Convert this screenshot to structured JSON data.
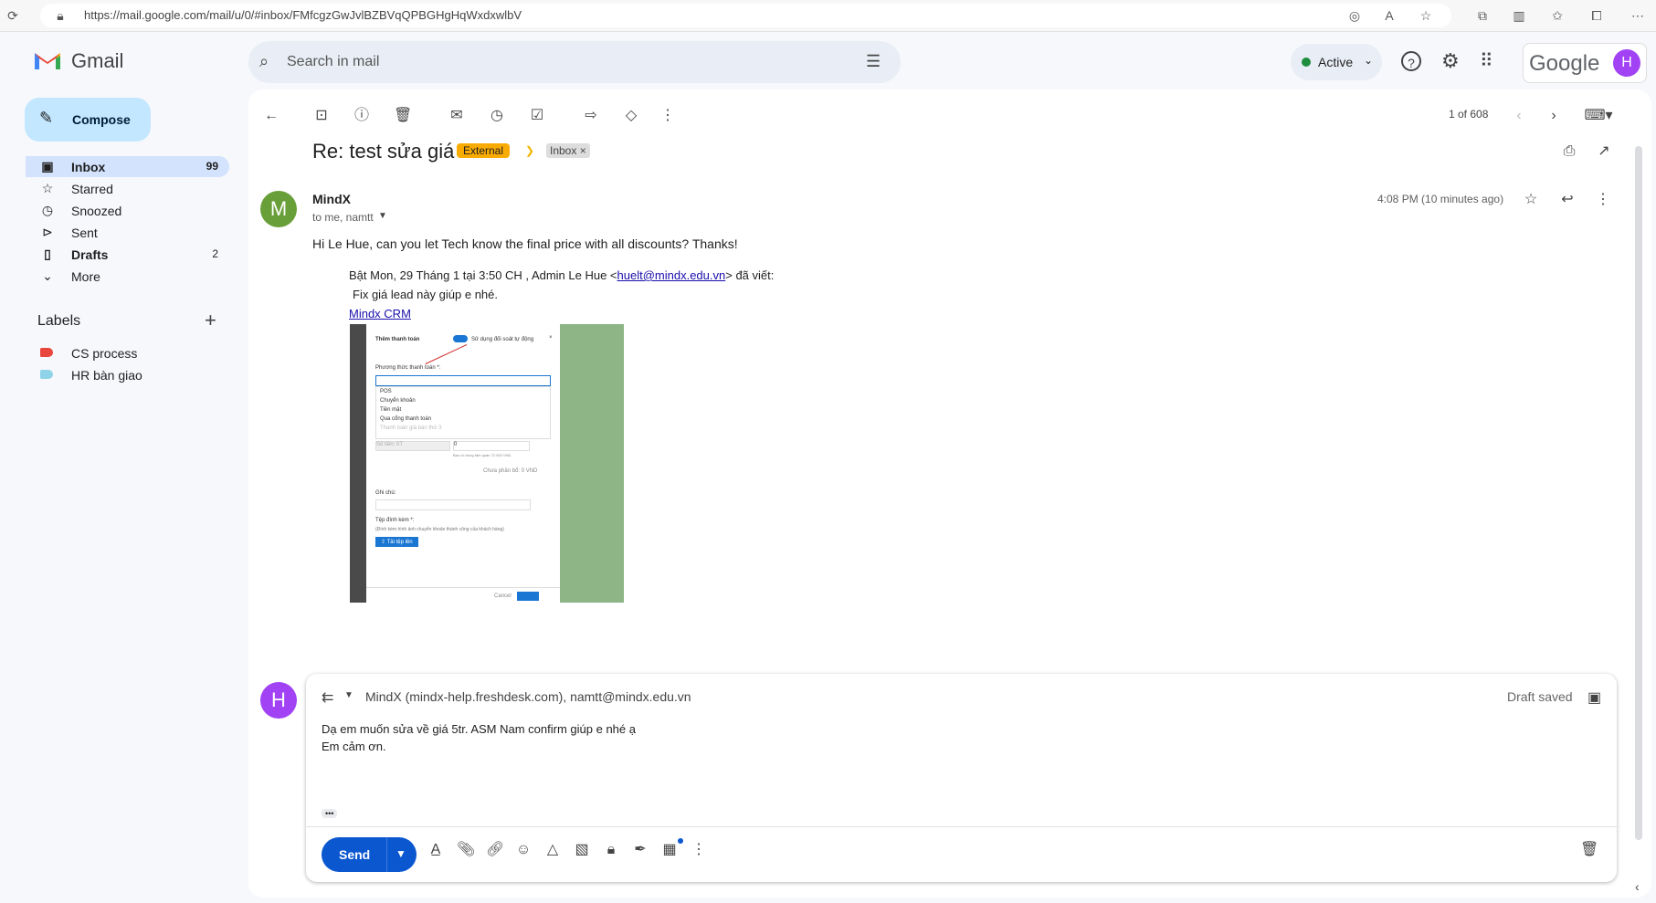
{
  "browser": {
    "url": "https://mail.google.com/mail/u/0/#inbox/FMfcgzGwJvlBZBVqQPBGHgHqWxdxwlbV"
  },
  "app": {
    "name": "Gmail",
    "compose_label": "Compose",
    "search_placeholder": "Search in mail",
    "status_label": "Active",
    "google_label": "Google",
    "avatar_initial": "H"
  },
  "sidebar": {
    "items": [
      {
        "label": "Inbox",
        "count": "99",
        "icon": "inbox-icon"
      },
      {
        "label": "Starred",
        "count": "",
        "icon": "star-icon"
      },
      {
        "label": "Snoozed",
        "count": "",
        "icon": "clock-icon"
      },
      {
        "label": "Sent",
        "count": "",
        "icon": "send-icon"
      },
      {
        "label": "Drafts",
        "count": "2",
        "icon": "draft-icon"
      },
      {
        "label": "More",
        "count": "",
        "icon": "chevron-down-icon"
      }
    ],
    "labels_title": "Labels",
    "labels": [
      {
        "name": "CS process",
        "color": "#e8453c"
      },
      {
        "name": "HR bàn giao",
        "color": "#8fd3e8"
      }
    ]
  },
  "toolbar": {
    "pagination": "1 of 608"
  },
  "email": {
    "subject": "Re: test sửa giá",
    "tag_external": "External",
    "tag_inbox": "Inbox",
    "tag_inbox_close": "×",
    "sender_name": "MindX",
    "sender_initial": "M",
    "recipients": "to me, namtt",
    "time": "4:08 PM (10 minutes ago)",
    "body": "Hi Le Hue, can you let Tech know the final price with all discounts? Thanks!",
    "quote_header_prefix": "Bật Mon, 29 Tháng 1 tại 3:50 CH , Admin Le Hue <",
    "quote_email": "huelt@mindx.edu.vn",
    "quote_header_suffix": "> đã viết:",
    "quote_line": "Fix giá lead này giúp e nhé.",
    "quote_link": "Mindx CRM"
  },
  "attachment": {
    "title": "Thêm thanh toán",
    "toggle_label": "Sử dụng đối soát tự động",
    "method_label": "Phương thức thanh toán *:",
    "options": [
      "POS",
      "Chuyển khoản",
      "Tiền mặt",
      "Qua cổng thanh toán",
      "Thanh toán giá bán thứ 3"
    ],
    "amount_label": "Số tiền: 0T",
    "amount_value": "0",
    "amount_hint": "Bạn có trong tâm quán 72.000 VND",
    "remain_label": "Chưa phân bổ: 0 VND",
    "note_label": "Ghi chú:",
    "attach_label": "Tệp đính kèm *:",
    "attach_hint": "(Đính kèm hình ảnh chuyển khoản thành công của khách hàng)",
    "upload_label": "⇪ Tải tệp lên",
    "cancel_label": "Cancel"
  },
  "reply": {
    "user_initial": "H",
    "recipients": "MindX (mindx-help.freshdesk.com), namtt@mindx.edu.vn",
    "draft_status": "Draft saved",
    "line1": "Dạ em muốn sửa về giá 5tr. ASM Nam confirm giúp e nhé ạ",
    "line2": "Em cảm ơn.",
    "expand": "•••",
    "send_label": "Send"
  },
  "colors": {
    "gmail_red": "#ea4335",
    "compose_bg": "#c2e7ff",
    "inbox_active_bg": "#d3e3fd",
    "search_bg": "#e9eef6",
    "external_tag": "#f9ab00",
    "send_blue": "#0b57d0",
    "link_blue": "#1a0dab",
    "avatar_purple": "#a142f4",
    "sender_avatar_green": "#689f38"
  }
}
